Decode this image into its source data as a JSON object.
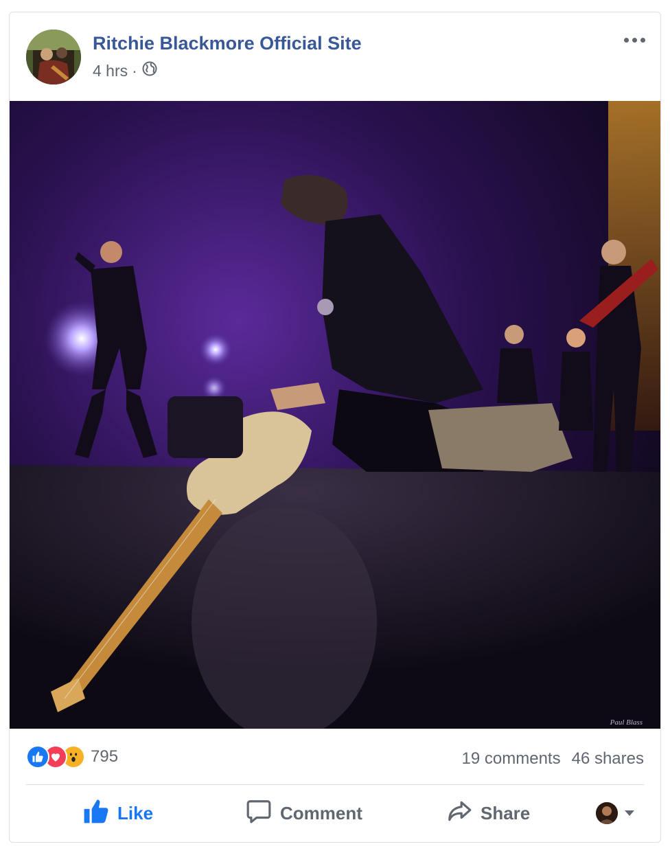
{
  "post": {
    "page_name": "Ritchie Blackmore Official Site",
    "time": "4 hrs",
    "separator": "·",
    "privacy_icon": "globe-icon"
  },
  "photo": {
    "watermark": "Paul Blass"
  },
  "stats": {
    "reaction_icons": [
      "like-reaction-icon",
      "love-reaction-icon",
      "wow-reaction-icon"
    ],
    "reaction_count": "795",
    "comments": "19 comments",
    "shares": "46 shares"
  },
  "actions": {
    "like": "Like",
    "comment": "Comment",
    "share": "Share"
  },
  "colors": {
    "link_blue": "#385898",
    "like_blue": "#1877f2",
    "love_red": "#f33e58",
    "wow_yellow": "#f7b125",
    "text_gray": "#606770"
  }
}
